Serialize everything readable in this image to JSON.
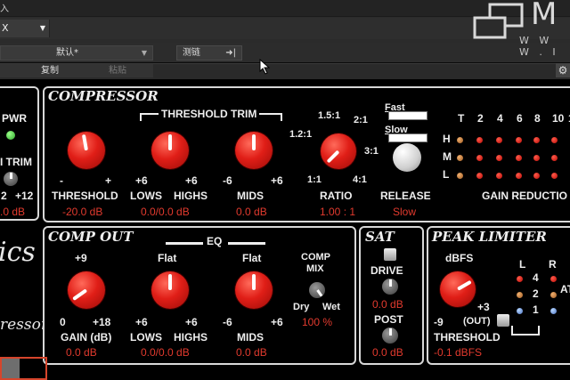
{
  "host": {
    "corner_label": "入",
    "tab_label": "X",
    "preset": "默认*",
    "compare_label": "测链",
    "copy_label": "复制",
    "paste_label": "粘贴"
  },
  "watermark": {
    "big": "M",
    "small": "W W W . I"
  },
  "left_edge": {
    "pwr": "PWR",
    "trim": "I TRIM",
    "trim_left": "2",
    "trim_right": "+12",
    "trim_value": ".0 dB",
    "script_a": "ics",
    "script_b": "ressor"
  },
  "compressor": {
    "title": "COMPRESSOR",
    "threshold_trim": "THRESHOLD TRIM",
    "threshold": {
      "min": "-",
      "max": "+",
      "label": "THRESHOLD",
      "value": "-20.0 dB"
    },
    "lows": {
      "scale": "+6",
      "label": "LOWS"
    },
    "highs": {
      "scale": "+6",
      "label": "HIGHS"
    },
    "lows_highs_value": "0.0/0.0 dB",
    "mids": {
      "min": "-6",
      "max": "+6",
      "label": "MIDS",
      "value": "0.0 dB"
    },
    "ratio": {
      "label": "RATIO",
      "value": "1.00 : 1",
      "marks": {
        "r1_5": "1.5:1",
        "r2": "2:1",
        "r1_2": "1.2:1",
        "r3": "3:1",
        "r1": "1:1",
        "r4": "4:1"
      }
    },
    "release": {
      "fast": "Fast",
      "slow": "Slow",
      "label": "RELEASE",
      "value": "Slow"
    },
    "gain_reduction": {
      "label": "GAIN REDUCTIO",
      "columns": [
        "T",
        "2",
        "4",
        "6",
        "8",
        "10",
        "1"
      ],
      "rows": [
        "H",
        "M",
        "L"
      ]
    }
  },
  "comp_out": {
    "title": "COMP OUT",
    "gain": {
      "max": "+9",
      "min": "0",
      "end": "+18",
      "label": "GAIN (dB)",
      "value": "0.0 dB"
    },
    "eq": "EQ",
    "lows": {
      "top": "Flat",
      "left": "+6",
      "right": "+6",
      "label": "LOWS"
    },
    "highs": {
      "label": "HIGHS"
    },
    "lows_highs_value": "0.0/0.0 dB",
    "mids": {
      "top": "Flat",
      "min": "-6",
      "max": "+6",
      "label": "MIDS",
      "value": "0.0 dB"
    },
    "mix": {
      "label_a": "COMP",
      "label_b": "MIX",
      "dry": "Dry",
      "wet": "Wet",
      "value": "100 %"
    }
  },
  "sat": {
    "title": "SAT",
    "drive": {
      "label": "DRIVE",
      "value": "0.0 dB"
    },
    "post": {
      "label": "POST",
      "value": "0.0 dB"
    }
  },
  "peak_limiter": {
    "title": "PEAK LIMITER",
    "dbfs": "dBFS",
    "plus3": "+3",
    "min": "-9",
    "out": "(OUT)",
    "threshold_label": "THRESHOLD",
    "threshold_value": "-0.1 dBFS",
    "meter": {
      "l": "L",
      "r": "R",
      "n4": "4",
      "n2": "2",
      "n1": "1",
      "att": "AT"
    }
  }
}
